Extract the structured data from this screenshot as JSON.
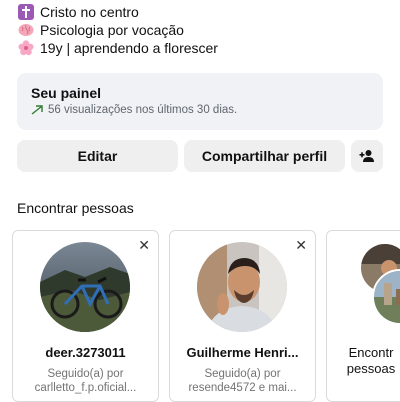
{
  "bio": {
    "lines": [
      {
        "icon": "latin-cross-icon",
        "text": "Cristo no centro"
      },
      {
        "icon": "brain-icon",
        "text": "Psicologia por vocação"
      },
      {
        "icon": "cherry-blossom-icon",
        "text": "19y | aprendendo a florescer"
      }
    ]
  },
  "panel": {
    "title": "Seu painel",
    "subtitle": "56 visualizações nos últimos 30 dias.",
    "trend_icon": "trending-up-icon",
    "accent": "#2e7d32"
  },
  "actions": {
    "edit_label": "Editar",
    "share_label": "Compartilhar perfil",
    "add_person_icon": "add-person-icon"
  },
  "discover": {
    "title": "Encontrar pessoas",
    "cards": [
      {
        "name": "deer.3273011",
        "line1": "Seguido(a) por",
        "line2": "carlletto_f.p.oficial..."
      },
      {
        "name": "Guilherme Henri...",
        "line1": "Seguido(a) por",
        "line2": "resende4572 e mai..."
      },
      {
        "name": "Encontr",
        "line1": "pessoas",
        "line2": ""
      }
    ]
  }
}
